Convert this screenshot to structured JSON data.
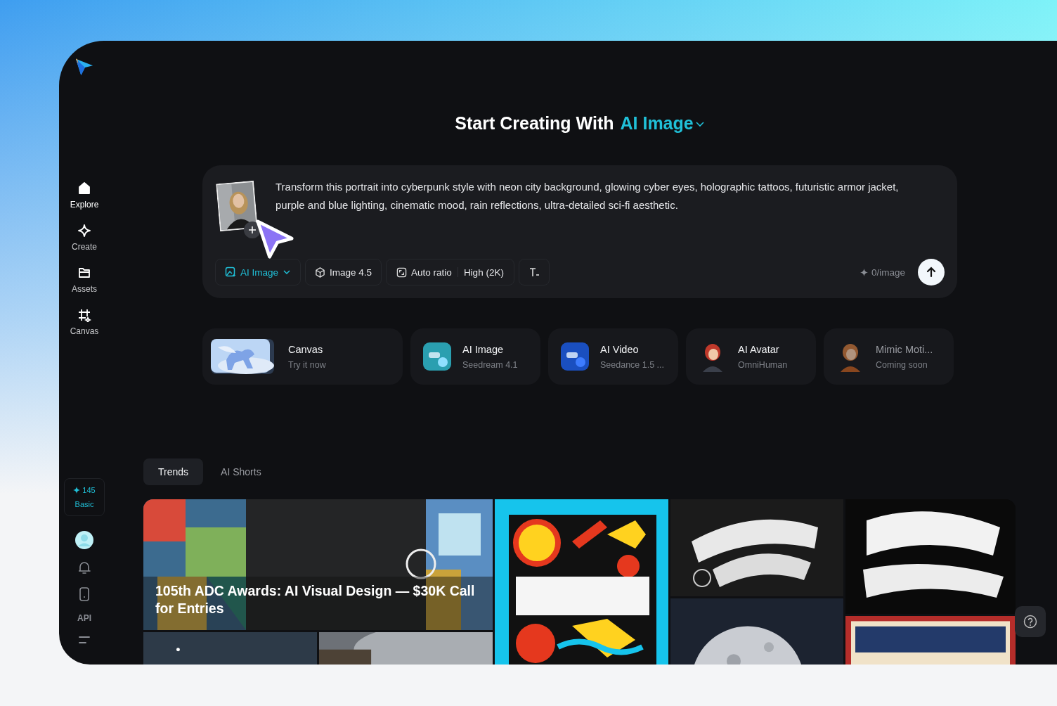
{
  "sidebar": {
    "nav": [
      {
        "label": "Explore",
        "selected": true
      },
      {
        "label": "Create",
        "selected": false
      },
      {
        "label": "Assets",
        "selected": false
      },
      {
        "label": "Canvas",
        "selected": false
      }
    ],
    "credits": {
      "count": "145",
      "plan": "Basic"
    },
    "api_label": "API"
  },
  "heading": {
    "text": "Start Creating With",
    "highlight": "AI Image"
  },
  "prompt": {
    "value": "Transform this portrait into cyberpunk style with neon city background, glowing cyber eyes, holographic tattoos, futuristic armor jacket, purple and blue lighting, cinematic mood, rain reflections, ultra-detailed sci-fi aesthetic.",
    "mode": "AI Image",
    "model": "Image 4.5",
    "ratio": "Auto ratio",
    "quality": "High (2K)",
    "cost": "0/image"
  },
  "features": [
    {
      "title": "Canvas",
      "subtitle": "Try it now",
      "disabled": false
    },
    {
      "title": "AI Image",
      "subtitle": "Seedream 4.1",
      "disabled": false
    },
    {
      "title": "AI Video",
      "subtitle": "Seedance 1.5 ...",
      "disabled": false
    },
    {
      "title": "AI Avatar",
      "subtitle": "OmniHuman",
      "disabled": false
    },
    {
      "title": "Mimic Moti...",
      "subtitle": "Coming soon",
      "disabled": true
    }
  ],
  "tabs": [
    {
      "label": "Trends",
      "selected": true
    },
    {
      "label": "AI Shorts",
      "selected": false
    }
  ],
  "gallery": {
    "banner_caption": "105th ADC Awards: AI Visual Design — $30K Call for Entries"
  }
}
